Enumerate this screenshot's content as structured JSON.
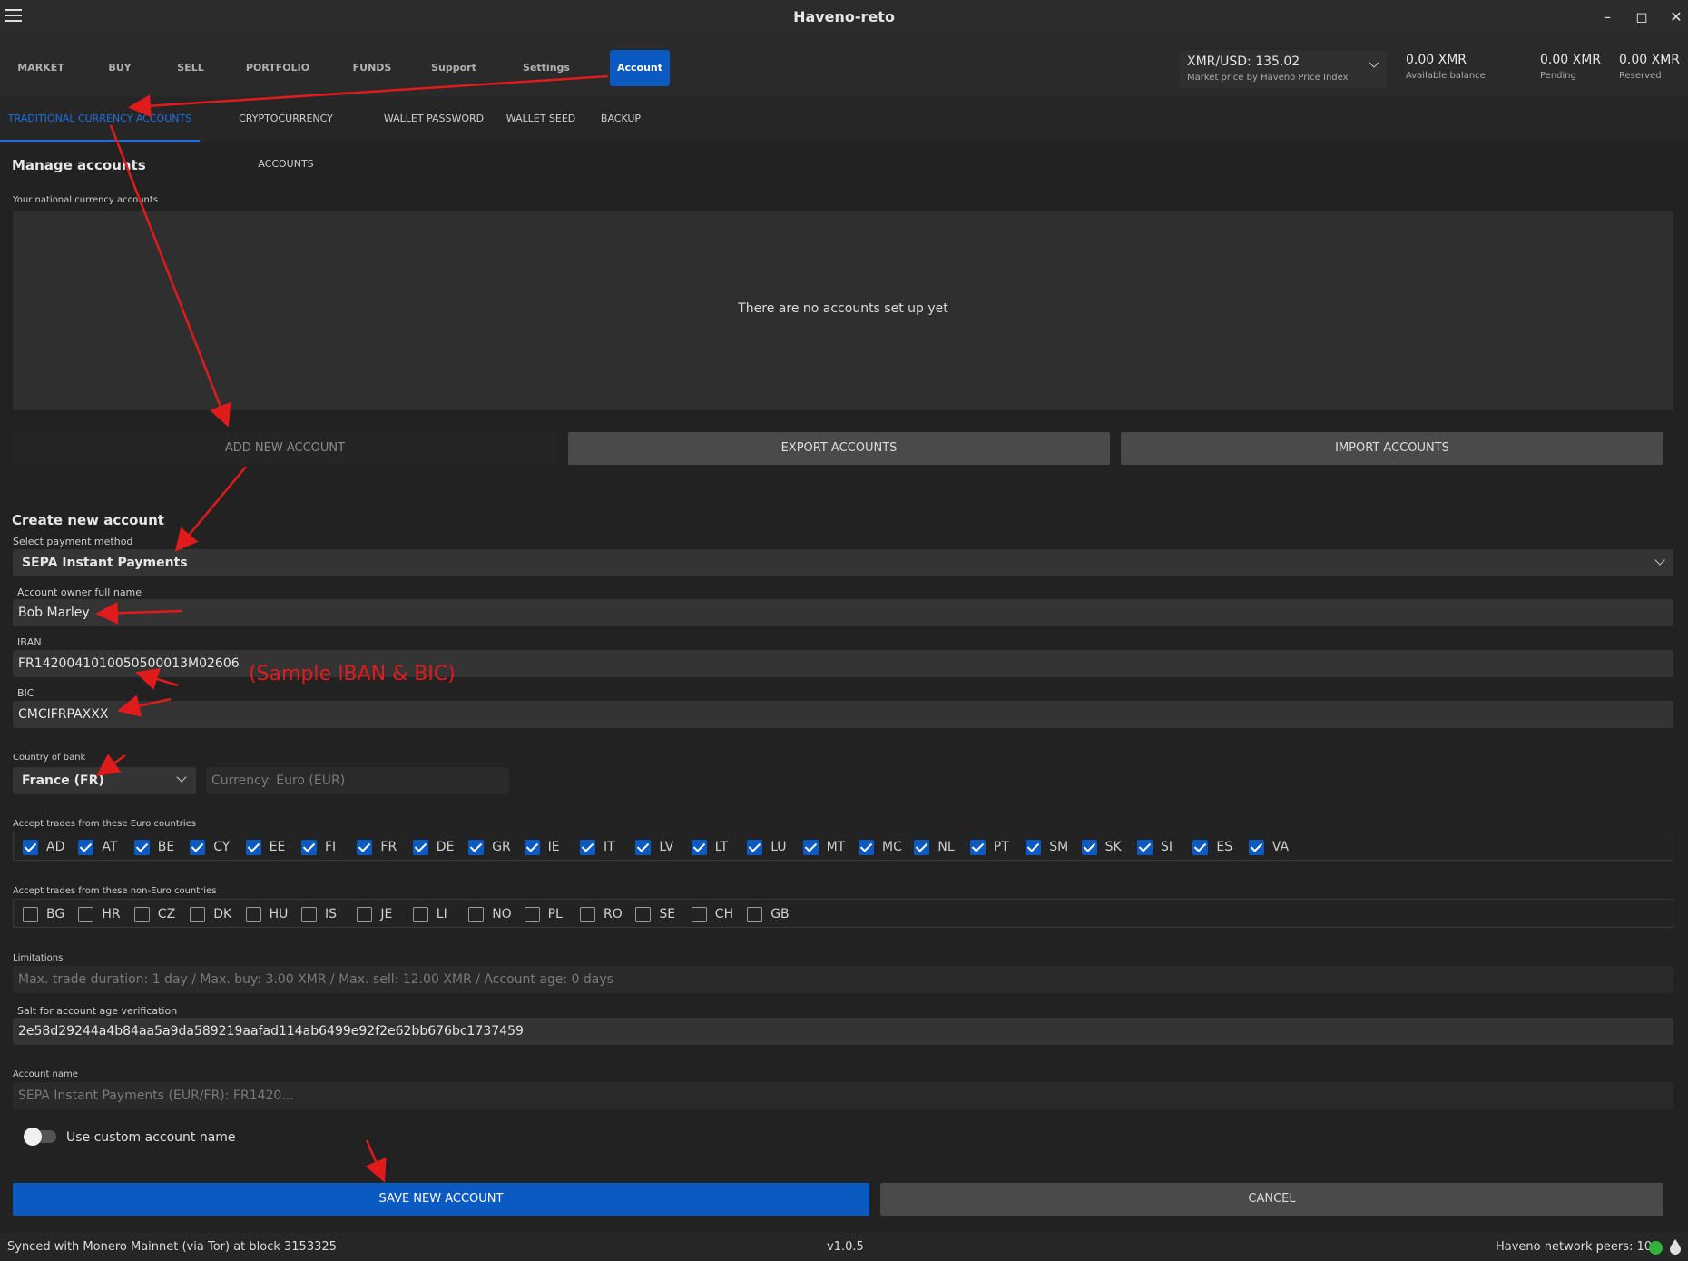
{
  "window": {
    "title": "Haveno-reto"
  },
  "nav": {
    "tabs": [
      "MARKET",
      "BUY",
      "SELL",
      "PORTFOLIO",
      "FUNDS",
      "Support",
      "Settings",
      "Account"
    ],
    "active": "Account"
  },
  "price": {
    "pair": "XMR/USD: 135.02",
    "source": "Market price by Haveno Price Index"
  },
  "balances": [
    {
      "value": "0.00 XMR",
      "label": "Available balance"
    },
    {
      "value": "0.00 XMR",
      "label": "Pending"
    },
    {
      "value": "0.00 XMR",
      "label": "Reserved"
    }
  ],
  "subtabs": [
    "TRADITIONAL CURRENCY ACCOUNTS",
    "CRYPTOCURRENCY ACCOUNTS",
    "WALLET PASSWORD",
    "WALLET SEED",
    "BACKUP"
  ],
  "manage": {
    "heading": "Manage accounts",
    "list_label": "Your national currency accounts",
    "empty_text": "There are no accounts set up yet",
    "add_button": "ADD NEW ACCOUNT",
    "export_button": "EXPORT ACCOUNTS",
    "import_button": "IMPORT ACCOUNTS"
  },
  "create": {
    "heading": "Create new account",
    "payment_method_label": "Select payment method",
    "payment_method_value": "SEPA Instant Payments",
    "owner_label": "Account owner full name",
    "owner_value": "Bob Marley",
    "iban_label": "IBAN",
    "iban_value": "FR1420041010050500013M02606",
    "bic_label": "BIC",
    "bic_value": "CMCIFRPAXXX",
    "country_label": "Country of bank",
    "country_value": "France (FR)",
    "currency_value": "Currency: Euro (EUR)",
    "euro_label": "Accept trades from these Euro countries",
    "euro_countries": [
      "AD",
      "AT",
      "BE",
      "CY",
      "EE",
      "FI",
      "FR",
      "DE",
      "GR",
      "IE",
      "IT",
      "LV",
      "LT",
      "LU",
      "MT",
      "MC",
      "NL",
      "PT",
      "SM",
      "SK",
      "SI",
      "ES",
      "VA"
    ],
    "non_euro_label": "Accept trades from these non-Euro countries",
    "non_euro_countries": [
      "BG",
      "HR",
      "CZ",
      "DK",
      "HU",
      "IS",
      "JE",
      "LI",
      "NO",
      "PL",
      "RO",
      "SE",
      "CH",
      "GB"
    ],
    "limitations_label": "Limitations",
    "limitations_value": "Max. trade duration: 1 day / Max. buy: 3.00 XMR / Max. sell: 12.00 XMR / Account age: 0 days",
    "salt_label": "Salt for account age verification",
    "salt_value": "2e58d29244a4b84aa5a9da589219aafad114ab6499e92f2e62bb676bc1737459",
    "account_name_label": "Account name",
    "account_name_value": "SEPA Instant Payments (EUR/FR): FR1420...",
    "custom_name_toggle": "Use custom account name",
    "save_button": "SAVE NEW ACCOUNT",
    "cancel_button": "CANCEL"
  },
  "status": {
    "sync": "Synced with Monero Mainnet (via Tor) at block 3153325",
    "version": "v1.0.5",
    "peers": "Haveno network peers: 10"
  },
  "annotation": {
    "note": "(Sample IBAN & BIC)",
    "color": "#e01b1b"
  },
  "colors": {
    "accent": "#0b5ac2",
    "background": "#222222",
    "peer_ok": "#2fb33b"
  }
}
